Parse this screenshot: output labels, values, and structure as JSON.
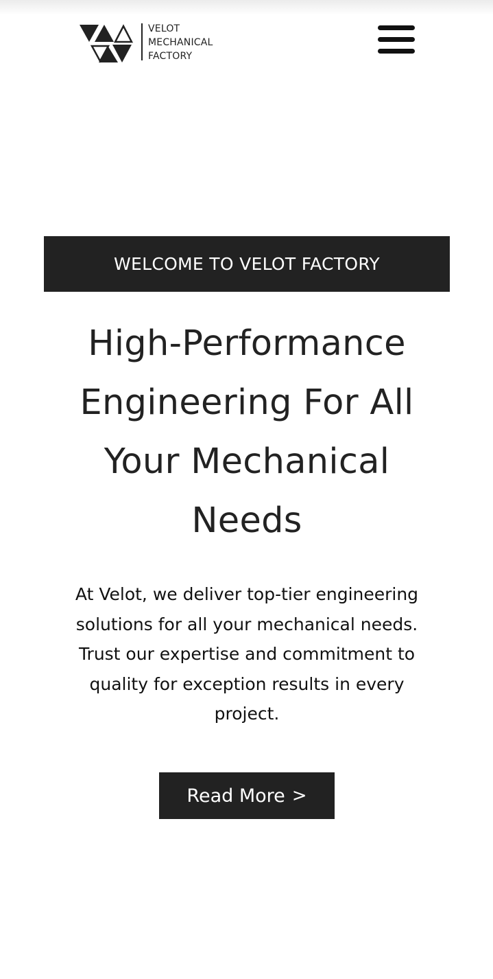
{
  "header": {
    "logo": {
      "lines": [
        "VELOT",
        "MECHANICAL",
        "FACTORY"
      ],
      "mark_icon": "triangles-logo-icon"
    },
    "menu_icon": "hamburger-menu-icon"
  },
  "hero": {
    "eyebrow": "WELCOME TO VELOT FACTORY",
    "title_lines": [
      "High-Performance",
      "Engineering For All",
      "Your Mechanical",
      "Needs"
    ],
    "description_lines": [
      "At Velot, we deliver top-tier engineering",
      "solutions for all your mechanical needs.",
      "Trust our expertise and commitment to",
      "quality for exception results in every",
      "project."
    ],
    "cta": {
      "label": "Read More",
      "arrow": ">"
    }
  },
  "colors": {
    "background": "#ffffff",
    "dark": "#222222",
    "text": "#111111",
    "on_dark": "#ffffff"
  }
}
